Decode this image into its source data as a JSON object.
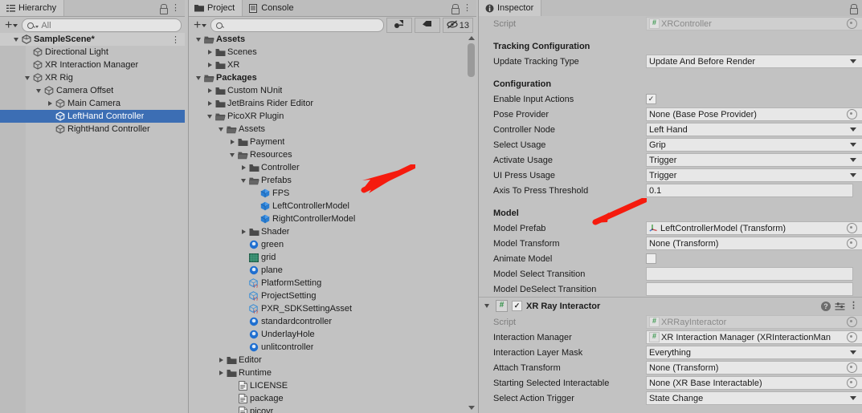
{
  "hierarchy": {
    "tab_label": "Hierarchy",
    "tab_icon": "hierarchy-icon",
    "lock_icon": "lock-icon",
    "menu_icon": "kebab-menu-icon",
    "toolbar": {
      "add_label": "+",
      "search_placeholder": "All",
      "search_value": ""
    },
    "items": [
      {
        "label": "SampleScene*",
        "depth": 1,
        "twisty": "down",
        "icon": "unity-scene-icon",
        "bold": true,
        "selected": false,
        "kebab": true
      },
      {
        "label": "Directional Light",
        "depth": 2,
        "twisty": "none",
        "icon": "gameobject-icon",
        "bold": false,
        "selected": false,
        "kebab": false
      },
      {
        "label": "XR Interaction Manager",
        "depth": 2,
        "twisty": "none",
        "icon": "gameobject-icon",
        "bold": false,
        "selected": false,
        "kebab": false
      },
      {
        "label": "XR Rig",
        "depth": 2,
        "twisty": "down",
        "icon": "gameobject-icon",
        "bold": false,
        "selected": false,
        "kebab": false
      },
      {
        "label": "Camera Offset",
        "depth": 3,
        "twisty": "down",
        "icon": "gameobject-icon",
        "bold": false,
        "selected": false,
        "kebab": false
      },
      {
        "label": "Main Camera",
        "depth": 4,
        "twisty": "right",
        "icon": "gameobject-icon",
        "bold": false,
        "selected": false,
        "kebab": false
      },
      {
        "label": "LeftHand Controller",
        "depth": 4,
        "twisty": "none",
        "icon": "gameobject-icon",
        "bold": false,
        "selected": true,
        "kebab": false
      },
      {
        "label": "RightHand Controller",
        "depth": 4,
        "twisty": "none",
        "icon": "gameobject-icon",
        "bold": false,
        "selected": false,
        "kebab": false
      }
    ]
  },
  "project": {
    "tabs": [
      {
        "label": "Project",
        "icon": "folder-icon",
        "active": true
      },
      {
        "label": "Console",
        "icon": "console-icon",
        "active": false
      }
    ],
    "lock_icon": "lock-icon",
    "menu_icon": "kebab-menu-icon",
    "toolbar": {
      "add_label": "+",
      "search_placeholder": "",
      "search_value": "",
      "filter_type_icon": "filter-by-type-icon",
      "filter_label_icon": "filter-by-label-icon",
      "hidden_count_icon": "eye-off-icon",
      "hidden_count": "13"
    },
    "items": [
      {
        "label": "Assets",
        "depth": 0,
        "twisty": "down",
        "icon": "folder-open-icon",
        "bold": true
      },
      {
        "label": "Scenes",
        "depth": 1,
        "twisty": "right",
        "icon": "folder-icon",
        "bold": false
      },
      {
        "label": "XR",
        "depth": 1,
        "twisty": "right",
        "icon": "folder-icon",
        "bold": false
      },
      {
        "label": "Packages",
        "depth": 0,
        "twisty": "down",
        "icon": "folder-open-icon",
        "bold": true
      },
      {
        "label": "Custom NUnit",
        "depth": 1,
        "twisty": "right",
        "icon": "folder-icon",
        "bold": false
      },
      {
        "label": "JetBrains Rider Editor",
        "depth": 1,
        "twisty": "right",
        "icon": "folder-icon",
        "bold": false
      },
      {
        "label": "PicoXR Plugin",
        "depth": 1,
        "twisty": "down",
        "icon": "folder-open-icon",
        "bold": false
      },
      {
        "label": "Assets",
        "depth": 2,
        "twisty": "down",
        "icon": "folder-open-icon",
        "bold": false
      },
      {
        "label": "Payment",
        "depth": 3,
        "twisty": "right",
        "icon": "folder-icon",
        "bold": false
      },
      {
        "label": "Resources",
        "depth": 3,
        "twisty": "down",
        "icon": "folder-open-icon",
        "bold": false
      },
      {
        "label": "Controller",
        "depth": 4,
        "twisty": "right",
        "icon": "folder-icon",
        "bold": false
      },
      {
        "label": "Prefabs",
        "depth": 4,
        "twisty": "down",
        "icon": "folder-open-icon",
        "bold": false
      },
      {
        "label": "FPS",
        "depth": 5,
        "twisty": "none",
        "icon": "prefab-icon",
        "bold": false
      },
      {
        "label": "LeftControllerModel",
        "depth": 5,
        "twisty": "none",
        "icon": "prefab-icon",
        "bold": false
      },
      {
        "label": "RightControllerModel",
        "depth": 5,
        "twisty": "none",
        "icon": "prefab-icon",
        "bold": false
      },
      {
        "label": "Shader",
        "depth": 4,
        "twisty": "right",
        "icon": "folder-icon",
        "bold": false
      },
      {
        "label": "green",
        "depth": 4,
        "twisty": "none",
        "icon": "material-icon",
        "bold": false
      },
      {
        "label": "grid",
        "depth": 4,
        "twisty": "none",
        "icon": "texture-icon",
        "bold": false
      },
      {
        "label": "plane",
        "depth": 4,
        "twisty": "none",
        "icon": "material-icon",
        "bold": false
      },
      {
        "label": "PlatformSetting",
        "depth": 4,
        "twisty": "none",
        "icon": "scriptable-object-icon",
        "bold": false
      },
      {
        "label": "ProjectSetting",
        "depth": 4,
        "twisty": "none",
        "icon": "scriptable-object-icon",
        "bold": false
      },
      {
        "label": "PXR_SDKSettingAsset",
        "depth": 4,
        "twisty": "none",
        "icon": "scriptable-object-icon",
        "bold": false
      },
      {
        "label": "standardcontroller",
        "depth": 4,
        "twisty": "none",
        "icon": "material-icon",
        "bold": false
      },
      {
        "label": "UnderlayHole",
        "depth": 4,
        "twisty": "none",
        "icon": "material-icon",
        "bold": false
      },
      {
        "label": "unlitcontroller",
        "depth": 4,
        "twisty": "none",
        "icon": "material-icon",
        "bold": false
      },
      {
        "label": "Editor",
        "depth": 2,
        "twisty": "right",
        "icon": "folder-icon",
        "bold": false
      },
      {
        "label": "Runtime",
        "depth": 2,
        "twisty": "right",
        "icon": "folder-icon",
        "bold": false
      },
      {
        "label": "LICENSE",
        "depth": 3,
        "twisty": "none",
        "icon": "text-file-icon",
        "bold": false
      },
      {
        "label": "package",
        "depth": 3,
        "twisty": "none",
        "icon": "text-file-icon",
        "bold": false
      },
      {
        "label": "picovr",
        "depth": 3,
        "twisty": "none",
        "icon": "text-file-icon",
        "bold": false
      }
    ]
  },
  "inspector": {
    "tab_label": "Inspector",
    "tab_icon": "info-icon",
    "lock_icon": "lock-icon",
    "components": [
      {
        "name": "xr-controller",
        "has_header": false,
        "rows": [
          {
            "kind": "object",
            "label": "Script",
            "label_dim": true,
            "value": "XRController",
            "value_dim": true,
            "badge": "script"
          },
          {
            "kind": "spacer"
          },
          {
            "kind": "section",
            "label": "Tracking Configuration"
          },
          {
            "kind": "dropdown",
            "label": "Update Tracking Type",
            "value": "Update And Before Render"
          },
          {
            "kind": "spacer"
          },
          {
            "kind": "section",
            "label": "Configuration"
          },
          {
            "kind": "checkbox",
            "label": "Enable Input Actions",
            "checked": true
          },
          {
            "kind": "object",
            "label": "Pose Provider",
            "value": "None (Base Pose Provider)"
          },
          {
            "kind": "dropdown",
            "label": "Controller Node",
            "value": "Left Hand"
          },
          {
            "kind": "dropdown",
            "label": "Select Usage",
            "value": "Grip"
          },
          {
            "kind": "dropdown",
            "label": "Activate Usage",
            "value": "Trigger"
          },
          {
            "kind": "dropdown",
            "label": "UI Press Usage",
            "value": "Trigger"
          },
          {
            "kind": "text",
            "label": "Axis To Press Threshold",
            "value": "0.1"
          },
          {
            "kind": "spacer"
          },
          {
            "kind": "section",
            "label": "Model"
          },
          {
            "kind": "object",
            "label": "Model Prefab",
            "value": "LeftControllerModel (Transform)",
            "badge": "transform"
          },
          {
            "kind": "object",
            "label": "Model Transform",
            "value": "None (Transform)"
          },
          {
            "kind": "checkbox",
            "label": "Animate Model",
            "checked": false
          },
          {
            "kind": "text",
            "label": "Model Select Transition",
            "value": ""
          },
          {
            "kind": "text",
            "label": "Model DeSelect Transition",
            "value": ""
          }
        ]
      },
      {
        "name": "xr-ray-interactor",
        "has_header": true,
        "header": {
          "title": "XR Ray Interactor",
          "enabled": true,
          "expanded": true,
          "script_badge": "#",
          "help_icon": "help-icon",
          "preset_icon": "preset-icon",
          "menu_icon": "kebab-menu-icon"
        },
        "rows": [
          {
            "kind": "object",
            "label": "Script",
            "label_dim": true,
            "value": "XRRayInteractor",
            "value_dim": true,
            "badge": "script"
          },
          {
            "kind": "object",
            "label": "Interaction Manager",
            "value": "XR Interaction Manager (XRInteractionMan",
            "badge": "script-green"
          },
          {
            "kind": "dropdown",
            "label": "Interaction Layer Mask",
            "value": "Everything"
          },
          {
            "kind": "object",
            "label": "Attach Transform",
            "value": "None (Transform)"
          },
          {
            "kind": "object",
            "label": "Starting Selected Interactable",
            "value": "None (XR Base Interactable)"
          },
          {
            "kind": "dropdown",
            "label": "Select Action Trigger",
            "value": "State Change"
          }
        ]
      }
    ]
  },
  "annotations": [
    {
      "name": "arrow-to-left-controller-model",
      "color": "#f51b0e"
    },
    {
      "name": "arrow-to-model-prefab",
      "color": "#f51b0e"
    }
  ],
  "colors": {
    "selection_blue": "#3c6eb4",
    "panel_bg": "#c2c2c2",
    "field_bg": "#e7e7e7",
    "annotation_red": "#f51b0e",
    "prefab_blue": "#2a7fd4",
    "material_blue": "#1f6fd0",
    "script_green": "#3f9a52"
  }
}
